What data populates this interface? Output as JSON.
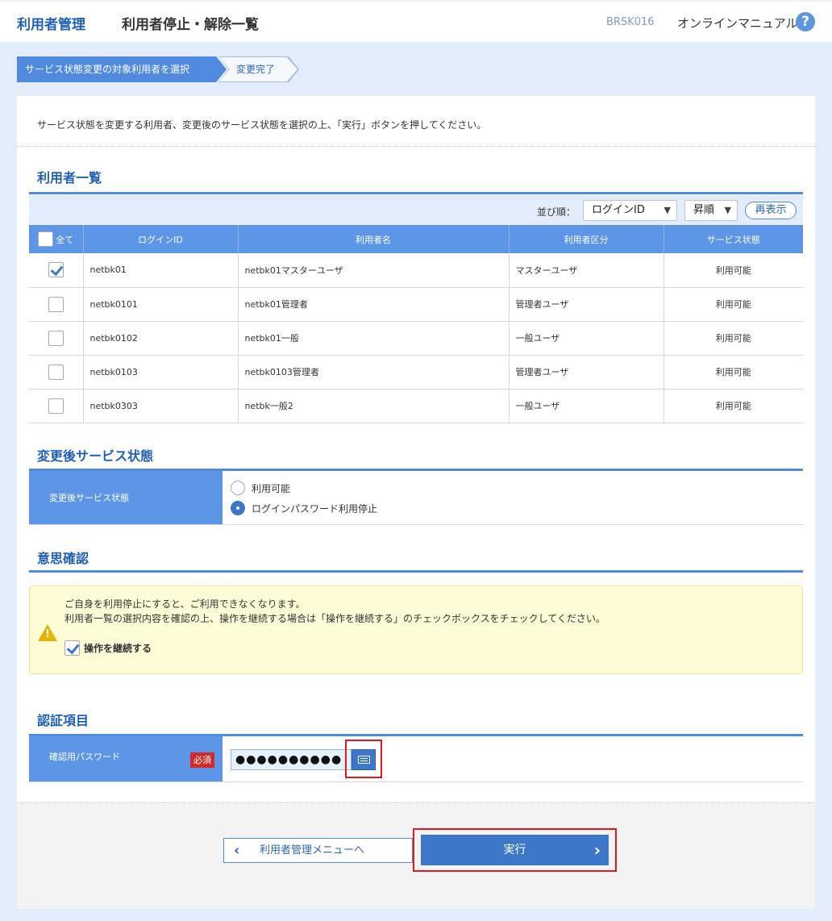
{
  "header": {
    "category": "利用者管理",
    "title": "利用者停止・解除一覧",
    "screen_code": "BRSK016",
    "manual_link": "オンラインマニュアル",
    "help_icon": "?"
  },
  "steps": [
    {
      "label": "サービス状態変更の対象利用者を選択",
      "active": true
    },
    {
      "label": "変更完了",
      "active": false
    }
  ],
  "intro": "サービス状態を変更する利用者、変更後のサービス状態を選択の上、「実行」ボタンを押してください。",
  "user_list": {
    "title": "利用者一覧",
    "sort_label": "並び順：",
    "sort_field": "ログインID",
    "sort_order": "昇順",
    "refresh_label": "再表示",
    "select_all_label": "全て",
    "columns": [
      "ログインID",
      "利用者名",
      "利用者区分",
      "サービス状態"
    ],
    "rows": [
      {
        "checked": true,
        "login_id": "netbk01",
        "name": "netbk01マスターユーザ",
        "type": "マスターユーザ",
        "status": "利用可能"
      },
      {
        "checked": false,
        "login_id": "netbk0101",
        "name": "netbk01管理者",
        "type": "管理者ユーザ",
        "status": "利用可能"
      },
      {
        "checked": false,
        "login_id": "netbk0102",
        "name": "netbk01一般",
        "type": "一般ユーザ",
        "status": "利用可能"
      },
      {
        "checked": false,
        "login_id": "netbk0103",
        "name": "netbk0103管理者",
        "type": "管理者ユーザ",
        "status": "利用可能"
      },
      {
        "checked": false,
        "login_id": "netbk0303",
        "name": "netbk一般2",
        "type": "一般ユーザ",
        "status": "利用可能"
      }
    ]
  },
  "service_status": {
    "title": "変更後サービス状態",
    "label": "変更後サービス状態",
    "options": [
      {
        "label": "利用可能",
        "selected": false
      },
      {
        "label": "ログインパスワード利用停止",
        "selected": true
      }
    ]
  },
  "confirm": {
    "title": "意思確認",
    "message1": "ご自身を利用停止にすると、ご利用できなくなります。",
    "message2": "利用者一覧の選択内容を確認の上、操作を継続する場合は「操作を継続する」のチェックボックスをチェックしてください。",
    "continue_label": "操作を継続する",
    "continue_checked": true
  },
  "auth": {
    "title": "認証項目",
    "password_label": "確認用パスワード",
    "required_badge": "必須",
    "password_value": "●●●●●●●●●●"
  },
  "buttons": {
    "back": "利用者管理メニューへ",
    "execute": "実行"
  },
  "colors": {
    "accent": "#3c77c9",
    "header_blue": "#5d96e6",
    "highlight_red": "#e0181f",
    "required_red": "#d12a2a"
  }
}
